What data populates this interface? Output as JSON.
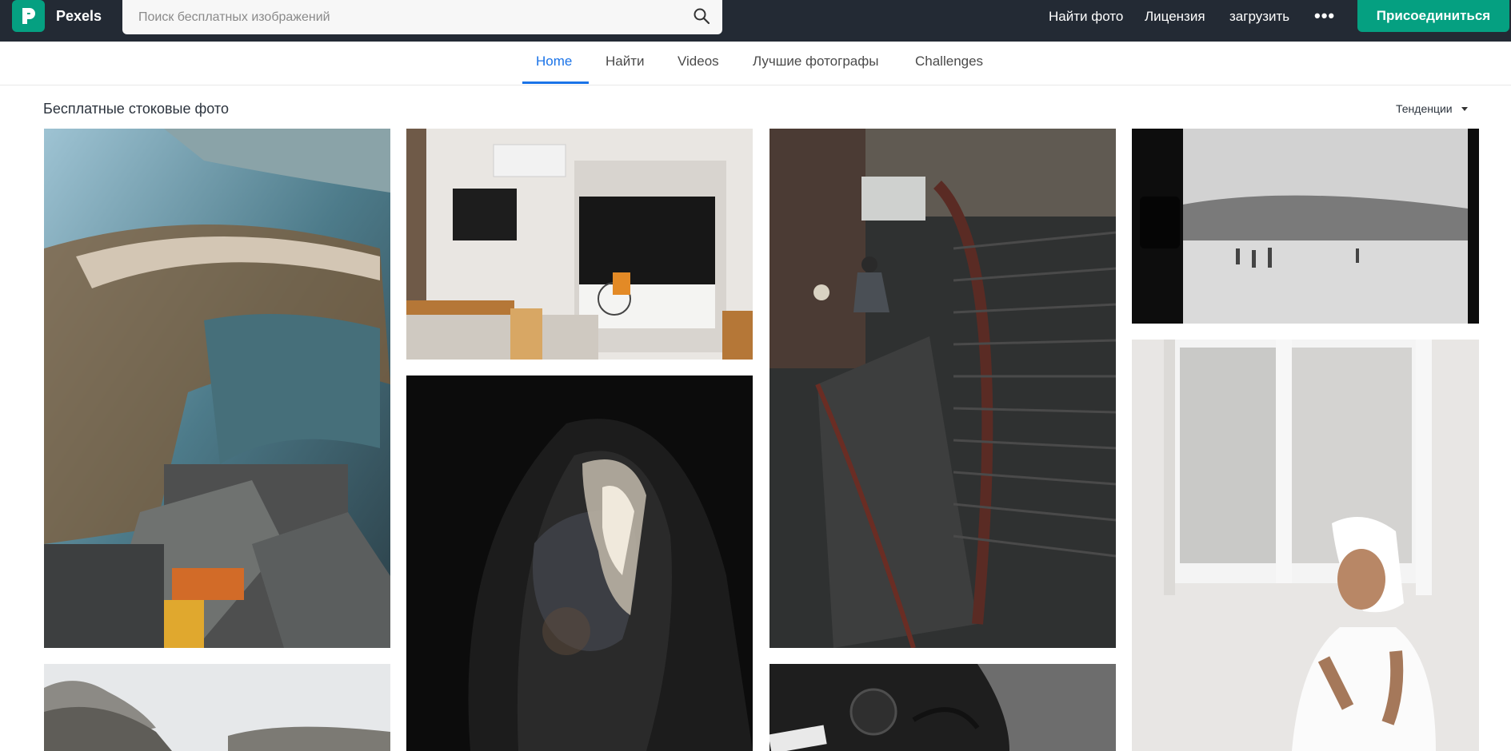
{
  "header": {
    "brand": "Pexels",
    "search_placeholder": "Поиск бесплатных изображений",
    "nav": [
      "Найти фото",
      "Лицензия",
      "загрузить"
    ],
    "more_label": "•••",
    "join_label": "Присоединиться"
  },
  "tabs": [
    {
      "label": "Home",
      "active": true
    },
    {
      "label": "Найти",
      "active": false
    },
    {
      "label": "Videos",
      "active": false
    },
    {
      "label": "Лучшие фотографы",
      "active": false
    },
    {
      "label": "Challenges",
      "active": false
    }
  ],
  "gallery": {
    "title": "Бесплатные стоковые фото",
    "sort_label": "Тенденции"
  },
  "photos": [
    {
      "subject": "helicopter-view"
    },
    {
      "subject": "kitchen-wheelchair"
    },
    {
      "subject": "dark-face-paint"
    },
    {
      "subject": "spiral-staircase"
    },
    {
      "subject": "beach-film"
    },
    {
      "subject": "woman-towel"
    },
    {
      "subject": "rocks-sea"
    },
    {
      "subject": "dark-objects"
    }
  ],
  "colors": {
    "brand": "#05a081",
    "header_bg": "#232a34",
    "active_tab": "#1a73e8"
  }
}
